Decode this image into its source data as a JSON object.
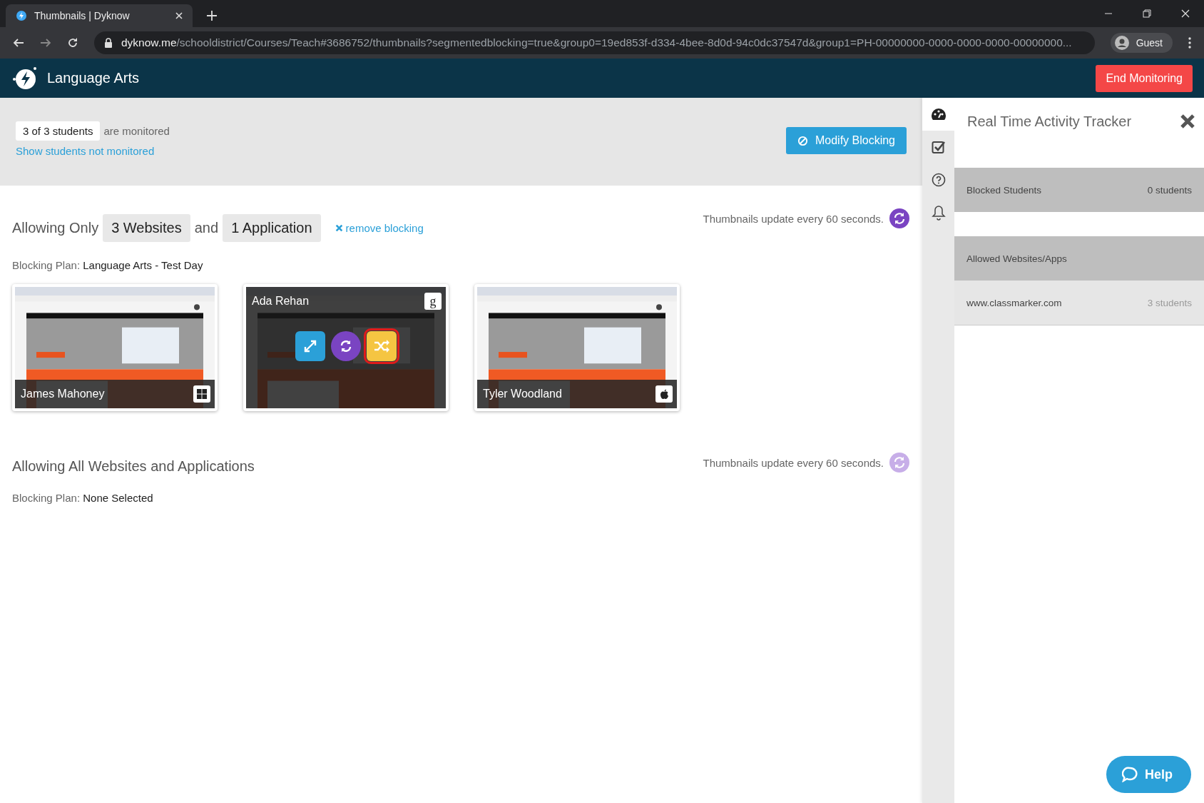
{
  "browser": {
    "tab_title": "Thumbnails | Dyknow",
    "url_domain": "dyknow.me",
    "url_path": "/schooldistrict/Courses/Teach#3686752/thumbnails?segmentedblocking=true&group0=19ed853f-d334-4bee-8d0d-94c0dc37547d&group1=PH-00000000-0000-0000-0000-00000000...",
    "profile": "Guest"
  },
  "header": {
    "title": "Language Arts",
    "end_button": "End Monitoring"
  },
  "summary": {
    "count": "3 of 3 students",
    "suffix": "are monitored",
    "link": "Show students not monitored",
    "modify_button": "Modify Blocking"
  },
  "groups": [
    {
      "kind": "restricted",
      "prefix": "Allowing Only",
      "chips": [
        "3 Websites",
        "1 Application"
      ],
      "joiner": "and",
      "remove": "remove blocking",
      "update_note": "Thumbnails update every 60 seconds.",
      "refresh_active": true,
      "plan_label": "Blocking Plan:",
      "plan_value": "Language Arts - Test Day",
      "students": [
        {
          "name": "James Mahoney",
          "kind": "windows",
          "hovered": false
        },
        {
          "name": "Ada Rehan",
          "kind": "chromeos",
          "os_label": "g",
          "hovered": true,
          "actions": [
            {
              "kind": "expand",
              "selected": false
            },
            {
              "kind": "refresh",
              "selected": false
            },
            {
              "kind": "shuffle",
              "selected": true
            }
          ]
        },
        {
          "name": "Tyler Woodland",
          "kind": "apple",
          "hovered": false
        }
      ]
    },
    {
      "kind": "open",
      "heading": "Allowing All Websites and Applications",
      "update_note": "Thumbnails update every 60 seconds.",
      "refresh_active": false,
      "plan_label": "Blocking Plan:",
      "plan_value": "None Selected"
    }
  ],
  "rail": [
    {
      "kind": "dashboard",
      "selected": true
    },
    {
      "kind": "checklist",
      "selected": false
    },
    {
      "kind": "help",
      "selected": false
    },
    {
      "kind": "bell",
      "selected": false
    }
  ],
  "panel": {
    "title": "Real Time Activity Tracker",
    "sections": [
      {
        "heading": "Blocked Students",
        "count": "0 students"
      },
      {
        "heading": "Allowed Websites/Apps",
        "items": [
          {
            "label": "www.classmarker.com",
            "count": "3 students"
          }
        ]
      }
    ]
  },
  "help_button": "Help"
}
